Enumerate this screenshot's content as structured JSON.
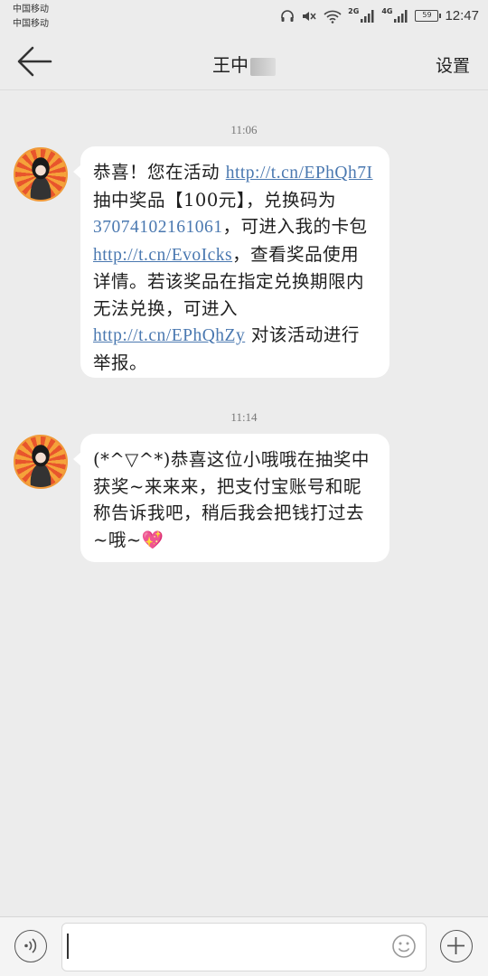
{
  "status_bar": {
    "carrier_1": "中国移动",
    "carrier_2": "中国移动",
    "net_2g": "2G",
    "net_4g": "4G",
    "battery": "59",
    "time": "12:47"
  },
  "header": {
    "title": "王",
    "title_extra": "中",
    "settings_label": "设置"
  },
  "messages": [
    {
      "timestamp": "11:06",
      "parts": {
        "t1": "恭喜！您在活动 ",
        "link1": "http://t.cn/EPhQh7I",
        "t2": " 抽中奖品【100元】，兑换码为 ",
        "code": "37074102161061",
        "t3": "，可进入我的卡包",
        "link2": "http://t.cn/EvoIcks",
        "t4": "，查看奖品使用详情。若该奖品在指定兑换期限内无法兑换，可进入 ",
        "link3": "http://t.cn/EPhQhZy",
        "t5": " 对该活动进行举报。"
      }
    },
    {
      "timestamp": "11:14",
      "text": "(*^▽^*)恭喜这位小哦哦在抽奖中获奖~来来来，把支付宝账号和昵称告诉我吧，稍后我会把钱打过去~哦~",
      "heart": "💖"
    }
  ],
  "input_bar": {
    "placeholder": ""
  },
  "colors": {
    "background": "#ececec",
    "bubble": "#ffffff",
    "link": "#4a78b0"
  }
}
